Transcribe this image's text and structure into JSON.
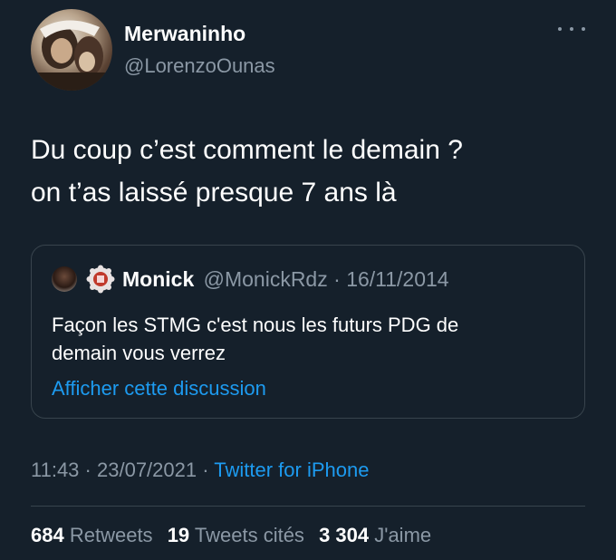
{
  "author": {
    "name": "Merwaninho",
    "handle": "@LorenzoOunas",
    "avatar_icon": "profile-photo"
  },
  "more_icon": "more-horizontal-icon",
  "tweet": {
    "lines": [
      "Du coup c’est comment le demain ?",
      "on t’as laissé presque 7 ans là"
    ]
  },
  "quoted": {
    "name": "Monick",
    "handle": "@MonickRdz",
    "separator": "·",
    "date": "16/11/2014",
    "lines": [
      "Façon les STMG c'est nous les futurs PDG de",
      "demain vous verrez"
    ],
    "show_thread_label": "Afficher cette discussion"
  },
  "meta": {
    "time": "11:43",
    "separator": "·",
    "date": "23/07/2021",
    "source": "Twitter for iPhone"
  },
  "stats": {
    "retweets_count": "684",
    "retweets_label": "Retweets",
    "quotes_count": "19",
    "quotes_label": "Tweets cités",
    "likes_count": "3 304",
    "likes_label": "J'aime"
  },
  "colors": {
    "background": "#15202b",
    "secondary_text": "#8b98a5",
    "link": "#1d9bf0",
    "border": "#38444d"
  }
}
